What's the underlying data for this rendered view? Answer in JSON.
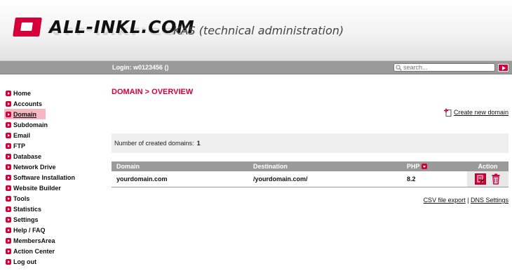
{
  "header": {
    "logo_text": "ALL-INKL.COM",
    "subtitle": "KAS (technical administration)"
  },
  "topbar": {
    "login_text": "Login: w0123456 ()",
    "search_placeholder": "search..."
  },
  "sidebar": {
    "items": [
      {
        "label": "Home"
      },
      {
        "label": "Accounts"
      },
      {
        "label": "Domain",
        "active": true
      },
      {
        "label": "Subdomain"
      },
      {
        "label": "Email"
      },
      {
        "label": "FTP"
      },
      {
        "label": "Database"
      },
      {
        "label": "Network Drive"
      },
      {
        "label": "Software Installation"
      },
      {
        "label": "Website Builder"
      },
      {
        "label": "Tools"
      },
      {
        "label": "Statistics"
      },
      {
        "label": "Settings"
      },
      {
        "label": "Help / FAQ"
      },
      {
        "label": "MembersArea"
      },
      {
        "label": "Action Center"
      },
      {
        "label": "Log out"
      }
    ]
  },
  "main": {
    "title": "DOMAIN > OVERVIEW",
    "create_link": "Create new domain",
    "count_label": "Number of created domains:",
    "count_value": "1",
    "table": {
      "headers": {
        "domain": "Domain",
        "destination": "Destination",
        "php": "PHP",
        "action": "Action"
      },
      "rows": [
        {
          "domain": "yourdomain.com",
          "destination": "/yourdomain.com/",
          "php": "8.2"
        }
      ]
    },
    "footer": {
      "csv": "CSV file export",
      "separator": "|",
      "dns": "DNS Settings"
    }
  },
  "colors": {
    "accent": "#d5003a",
    "bar": "#9a9a9a"
  }
}
